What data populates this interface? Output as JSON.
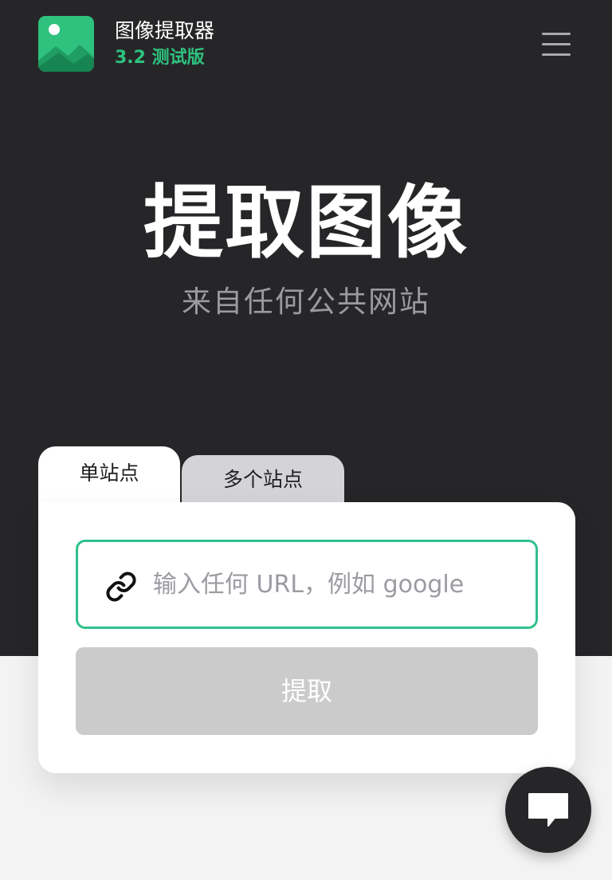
{
  "header": {
    "app_name": "图像提取器",
    "version": "3.2 测试版",
    "logo_icon": "image-icon",
    "menu_icon": "hamburger-menu-icon"
  },
  "hero": {
    "title": "提取图像",
    "subtitle": "来自任何公共网站"
  },
  "tabs": [
    {
      "label": "单站点",
      "active": true
    },
    {
      "label": "多个站点",
      "active": false
    }
  ],
  "form": {
    "url_placeholder": "输入任何 URL，例如 google",
    "url_value": "",
    "link_icon": "link-icon",
    "submit_label": "提取"
  },
  "chat": {
    "icon": "chat-bubble-icon"
  },
  "colors": {
    "hero_bg": "#262628",
    "accent": "#2ec27e",
    "input_border": "#2fc08a",
    "button_disabled": "#cbcbcb",
    "page_bg": "#f3f3f4"
  }
}
